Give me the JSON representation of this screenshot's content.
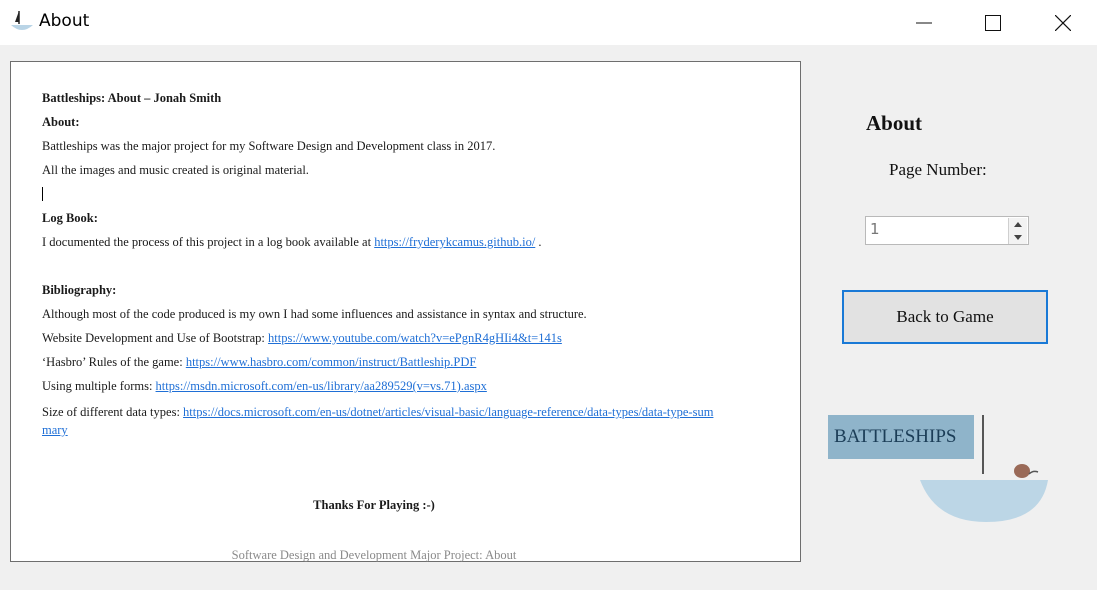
{
  "window": {
    "title": "About",
    "controls": [
      "minimize",
      "maximize",
      "close"
    ]
  },
  "document": {
    "heading": "Battleships: About – Jonah Smith",
    "about_label": "About:",
    "about_line1": "Battleships was the major project for my Software Design and Development class in 2017.",
    "about_line2": "All the images and music created is original material.",
    "logbook_label": "Log Book:",
    "logbook_text": "I documented the process of this project in a log book available at ",
    "logbook_link": "https://fryderykcamus.github.io/",
    "logbook_end": " .",
    "bibliography_label": "Bibliography:",
    "bib_intro": "Although most of the code produced is my own I had some influences and assistance in syntax and structure.",
    "refs": [
      {
        "label": "Website Development and Use of Bootstrap: ",
        "url": "https://www.youtube.com/watch?v=ePgnR4gHIi4&t=141s"
      },
      {
        "label": "‘Hasbro’ Rules of the game: ",
        "url": "https://www.hasbro.com/common/instruct/Battleship.PDF"
      },
      {
        "label": "Using multiple forms: ",
        "url": "https://msdn.microsoft.com/en-us/library/aa289529(v=vs.71).aspx"
      },
      {
        "label": "Size of different data types: ",
        "url": "https://docs.microsoft.com/en-us/dotnet/articles/visual-basic/language-reference/data-types/data-type-summary"
      }
    ],
    "thanks": "Thanks For Playing :-)",
    "footer": "Software Design and Development Major Project: About"
  },
  "sidebar": {
    "title": "About",
    "page_number_label": "Page Number:",
    "page_number_value": "1",
    "back_button_label": "Back to Game"
  },
  "logo": {
    "text": "BATTLESHIPS",
    "colors": {
      "banner": "#8fb4ca",
      "bowl": "#bcd6e6",
      "ball": "#9a6a58"
    }
  }
}
